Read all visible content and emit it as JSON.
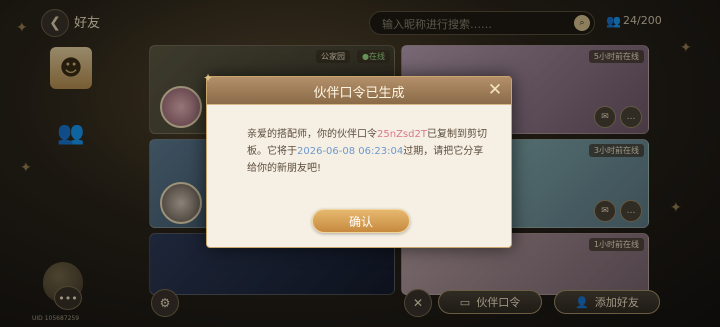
{
  "header": {
    "back_icon": "back-arrow-icon",
    "title": "好友",
    "search_placeholder": "输入昵称进行搜索……",
    "friend_count": "24/200"
  },
  "sidebar": {
    "uid": "UID 105687259",
    "items": [
      {
        "name": "tab-friends",
        "icon": "avatar-icon",
        "active": true
      },
      {
        "name": "tab-groups",
        "icon": "people-icon",
        "active": false
      }
    ]
  },
  "cards": [
    {
      "badge_left": "公家园",
      "badge_right": "●在线"
    },
    {
      "badge_right": "5小时前在线"
    },
    {
      "badge_right": "3小时前在线"
    },
    {
      "badge_right": "1小时前在线"
    }
  ],
  "bottom_bar": {
    "partner_code_label": "伙伴口令",
    "add_friend_label": "添加好友"
  },
  "dialog": {
    "title": "伙伴口令已生成",
    "body_part1": "亲爱的搭配师，你的伙伴口令",
    "code": "25nZsd2T",
    "body_part2": "已复制到剪切板。它将于",
    "expire_time": "2026-06-08 06:23:04",
    "body_part3": "过期，请把它分享给你的新朋友吧!",
    "confirm_label": "确认"
  },
  "colors": {
    "accent_gold": "#c78a3f",
    "code_pink": "#d87a86",
    "time_blue": "#6e98d0"
  }
}
